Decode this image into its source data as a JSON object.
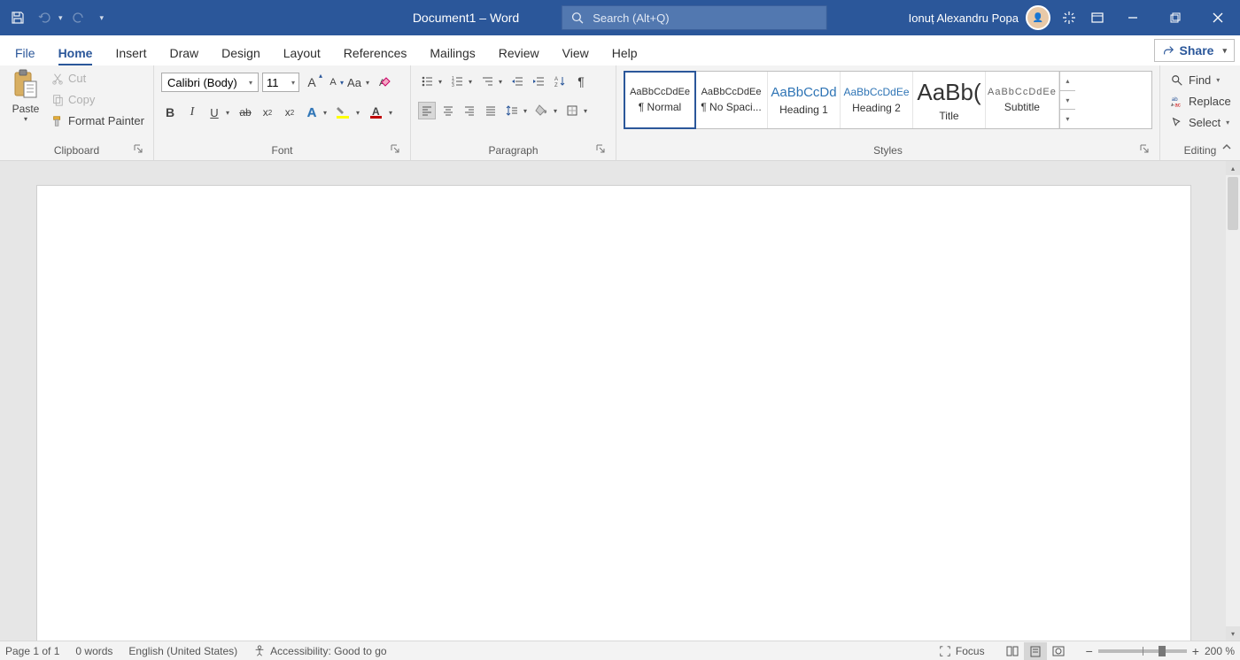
{
  "titlebar": {
    "document_name": "Document1",
    "app_separator": " – ",
    "app_name": "Word",
    "search_placeholder": "Search (Alt+Q)",
    "user_name": "Ionuț Alexandru Popa"
  },
  "tabs": {
    "items": [
      "File",
      "Home",
      "Insert",
      "Draw",
      "Design",
      "Layout",
      "References",
      "Mailings",
      "Review",
      "View",
      "Help"
    ],
    "active": "Home",
    "share_label": "Share"
  },
  "ribbon": {
    "clipboard": {
      "paste_label": "Paste",
      "cut_label": "Cut",
      "copy_label": "Copy",
      "format_painter_label": "Format Painter",
      "group_label": "Clipboard"
    },
    "font": {
      "font_name": "Calibri (Body)",
      "font_size": "11",
      "group_label": "Font"
    },
    "paragraph": {
      "group_label": "Paragraph"
    },
    "styles": {
      "group_label": "Styles",
      "items": [
        {
          "preview": "AaBbCcDdEe",
          "label": "¶ Normal",
          "size": "11px",
          "color": "#333333",
          "selected": true
        },
        {
          "preview": "AaBbCcDdEe",
          "label": "¶ No Spaci...",
          "size": "11px",
          "color": "#333333",
          "selected": false
        },
        {
          "preview": "AaBbCcDd",
          "label": "Heading 1",
          "size": "15px",
          "color": "#2e74b5",
          "selected": false
        },
        {
          "preview": "AaBbCcDdEe",
          "label": "Heading 2",
          "size": "12px",
          "color": "#2e74b5",
          "selected": false
        },
        {
          "preview": "AaBb(",
          "label": "Title",
          "size": "26px",
          "color": "#333333",
          "selected": false
        },
        {
          "preview": "AaBbCcDdEe",
          "label": "Subtitle",
          "size": "11px",
          "color": "#666666",
          "selected": false,
          "spacing": "1px"
        }
      ]
    },
    "editing": {
      "find_label": "Find",
      "replace_label": "Replace",
      "select_label": "Select",
      "group_label": "Editing"
    }
  },
  "status": {
    "page_info": "Page 1 of 1",
    "word_count": "0 words",
    "language": "English (United States)",
    "accessibility": "Accessibility: Good to go",
    "focus_label": "Focus",
    "zoom_value": "200 %"
  }
}
